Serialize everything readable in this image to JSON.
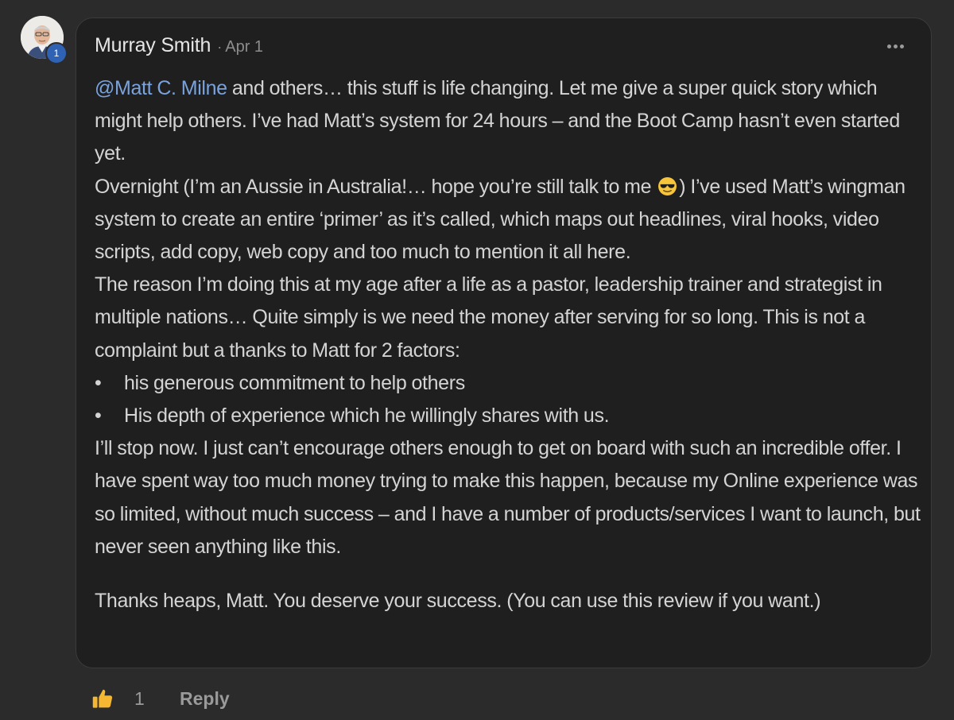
{
  "comment": {
    "author": "Murray Smith",
    "separator": "·",
    "date": "Apr 1",
    "level_badge": "1",
    "mention": "@Matt C. Milne",
    "paragraph1_rest": " and others… this stuff is life changing. Let me give a super quick story which might help others. I’ve had Matt’s system for 24 hours – and the Boot Camp hasn’t even started yet.",
    "paragraph2_a": "Overnight (I’m an Aussie in Australia!… hope you’re still talk to me ",
    "paragraph2_b": ") I’ve used Matt’s wingman system to create an entire ‘primer’ as it’s called, which maps out headlines, viral hooks, video scripts, add copy, web copy and too much to mention it all here.",
    "paragraph3": "The reason I’m doing this at my age after a life as a pastor, leadership trainer and strategist in multiple nations… Quite simply is we need the money after serving for so long. This is not a complaint but a thanks to Matt for 2 factors:",
    "bullets": [
      "his generous commitment to help others",
      "His depth of experience which he willingly shares with us."
    ],
    "bullet_char": "•",
    "paragraph4": "I’ll stop now. I just can’t encourage others enough to get on board with such an incredible offer. I have spent way too much money trying to make this happen, because my Online experience was so limited, without much success – and I have a number of products/services I want to launch, but never seen anything like this.",
    "paragraph5": "Thanks heaps, Matt. You deserve your success. (You can use this review if you want.)",
    "emoji_icon": "sunglasses-emoji-icon"
  },
  "actions": {
    "like_icon": "thumbs-up-icon",
    "like_count": "1",
    "reply_label": "Reply",
    "like_color": "#f5b731"
  },
  "colors": {
    "background": "#2b2b2c",
    "card": "#1f1f1f",
    "mention": "#7aa3dd",
    "badge": "#2f62b3"
  }
}
